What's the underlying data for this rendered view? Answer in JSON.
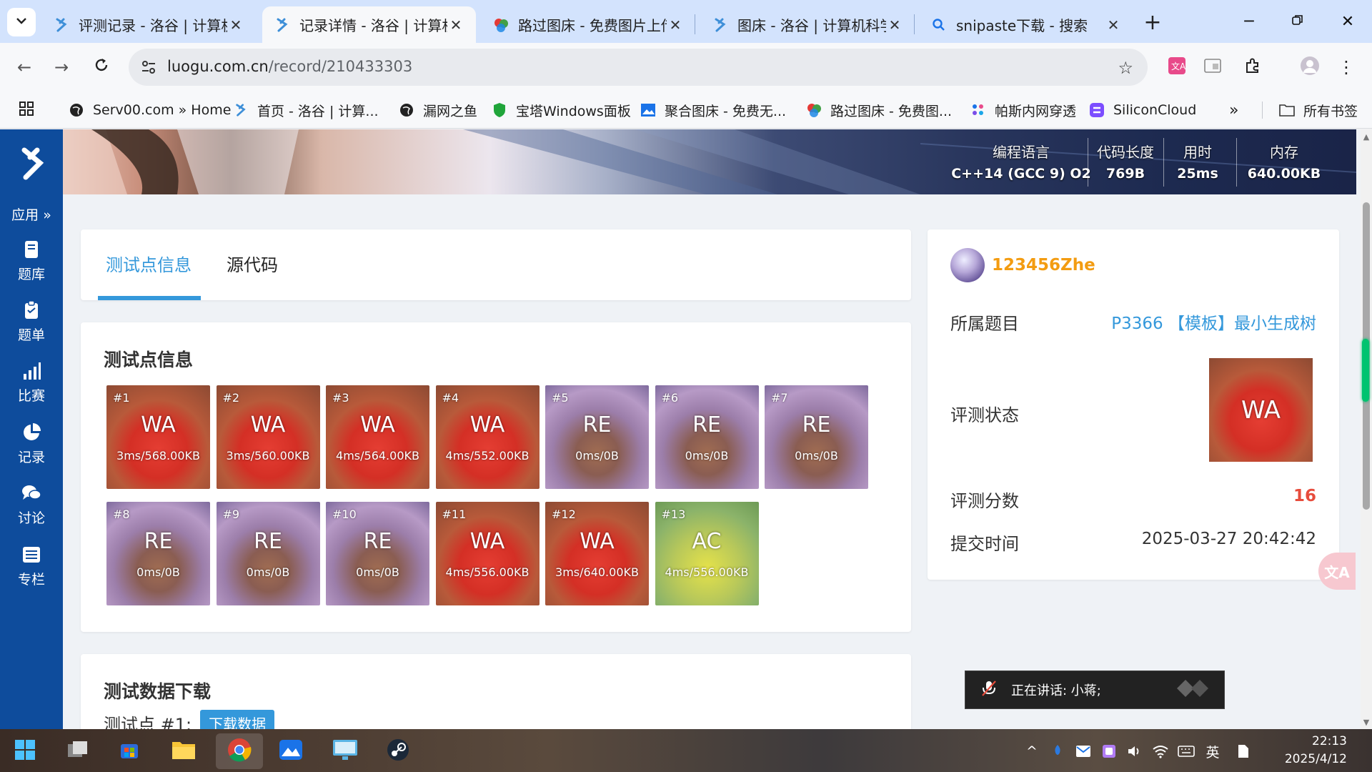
{
  "browser": {
    "tabs": [
      {
        "title": "评测记录 - 洛谷 | 计算机"
      },
      {
        "title": "记录详情 - 洛谷 | 计算机"
      },
      {
        "title": "路过图床 - 免费图片上传"
      },
      {
        "title": "图床 - 洛谷 | 计算机科学"
      },
      {
        "title": "snipaste下载 - 搜索"
      }
    ],
    "url_host": "luogu.com.cn",
    "url_path": "/record/210433303",
    "bookmarks": [
      "Serv00.com » Home",
      "首页 - 洛谷 | 计算...",
      "漏网之鱼",
      "宝塔Windows面板",
      "聚合图床 - 免费无...",
      "路过图床 - 免费图...",
      "帕斯内网穿透",
      "SiliconCloud"
    ],
    "all_bookmarks": "所有书签",
    "more": "»"
  },
  "sidebar": {
    "apps_label": "应用 »",
    "items": [
      {
        "label": "题库"
      },
      {
        "label": "题单"
      },
      {
        "label": "比赛"
      },
      {
        "label": "记录"
      },
      {
        "label": "讨论"
      },
      {
        "label": "专栏"
      }
    ]
  },
  "banner": {
    "stats": [
      {
        "key": "编程语言",
        "value": "C++14 (GCC 9) O2"
      },
      {
        "key": "代码长度",
        "value": "769B"
      },
      {
        "key": "用时",
        "value": "25ms"
      },
      {
        "key": "内存",
        "value": "640.00KB"
      }
    ]
  },
  "page_tabs": {
    "tab1": "测试点信息",
    "tab2": "源代码"
  },
  "testcases": {
    "title": "测试点信息",
    "items": [
      {
        "id": "#1",
        "status": "WA",
        "info": "3ms/568.00KB"
      },
      {
        "id": "#2",
        "status": "WA",
        "info": "3ms/560.00KB"
      },
      {
        "id": "#3",
        "status": "WA",
        "info": "4ms/564.00KB"
      },
      {
        "id": "#4",
        "status": "WA",
        "info": "4ms/552.00KB"
      },
      {
        "id": "#5",
        "status": "RE",
        "info": "0ms/0B"
      },
      {
        "id": "#6",
        "status": "RE",
        "info": "0ms/0B"
      },
      {
        "id": "#7",
        "status": "RE",
        "info": "0ms/0B"
      },
      {
        "id": "#8",
        "status": "RE",
        "info": "0ms/0B"
      },
      {
        "id": "#9",
        "status": "RE",
        "info": "0ms/0B"
      },
      {
        "id": "#10",
        "status": "RE",
        "info": "0ms/0B"
      },
      {
        "id": "#11",
        "status": "WA",
        "info": "4ms/556.00KB"
      },
      {
        "id": "#12",
        "status": "WA",
        "info": "3ms/640.00KB"
      },
      {
        "id": "#13",
        "status": "AC",
        "info": "4ms/556.00KB"
      }
    ]
  },
  "download": {
    "title": "测试数据下载",
    "row_label": "测试点 #1:",
    "button": "下载数据"
  },
  "record": {
    "username": "123456Zhe",
    "problem_label": "所属题目",
    "problem_value": "P3366 【模板】最小生成树",
    "status_label": "评测状态",
    "status_value": "WA",
    "score_label": "评测分数",
    "score_value": "16",
    "time_label": "提交时间",
    "time_value": "2025-03-27 20:42:42"
  },
  "float_button": "文A",
  "voice": {
    "text": "正在讲话:  小蒋;"
  },
  "taskbar": {
    "ime": "英",
    "time": "22:13",
    "date": "2025/4/12"
  },
  "colors": {
    "accent": "#3498db",
    "sidebar": "#0e4c9c",
    "username": "#f39c11",
    "score": "#e74c3c",
    "wa": "#d42f25",
    "re": "#9c7eaa",
    "ac": "#b8c85a"
  }
}
